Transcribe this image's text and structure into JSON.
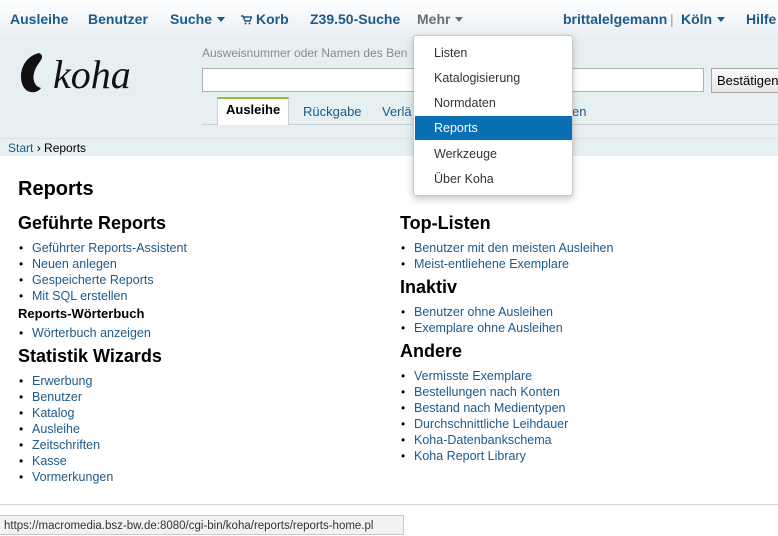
{
  "topnav": {
    "ausleihe": "Ausleihe",
    "benutzer": "Benutzer",
    "suche": "Suche",
    "korb": "Korb",
    "z3950": "Z39.50-Suche",
    "mehr": "Mehr",
    "user": "brittalelgemann",
    "separator": "|",
    "branch": "Köln",
    "hilfe": "Hilfe"
  },
  "search": {
    "hint": "Ausweisnummer oder Namen des Ben",
    "value": "",
    "submit": "Bestätigen"
  },
  "tabs": [
    "Ausleihe",
    "Rückgabe",
    "Verlä",
    "en"
  ],
  "breadcrumb": {
    "start": "Start",
    "separator": "›",
    "current": "Reports"
  },
  "dropdown": {
    "items": [
      "Listen",
      "Katalogisierung",
      "Normdaten",
      "Reports",
      "Werkzeuge",
      "Über Koha"
    ],
    "selected": "Reports"
  },
  "main": {
    "title": "Reports",
    "guided": {
      "heading": "Geführte Reports",
      "links": [
        "Geführter Reports-Assistent",
        "Neuen anlegen",
        "Gespeicherte Reports",
        "Mit SQL erstellen"
      ]
    },
    "dictionary": {
      "heading": "Reports-Wörterbuch",
      "links": [
        "Wörterbuch anzeigen"
      ]
    },
    "wizards": {
      "heading": "Statistik Wizards",
      "links": [
        "Erwerbung",
        "Benutzer",
        "Katalog",
        "Ausleihe",
        "Zeitschriften",
        "Kasse",
        "Vormerkungen"
      ]
    },
    "top": {
      "heading": "Top-Listen",
      "links": [
        "Benutzer mit den meisten Ausleihen",
        "Meist-entliehene Exemplare"
      ]
    },
    "inactive": {
      "heading": "Inaktiv",
      "links": [
        "Benutzer ohne Ausleihen",
        "Exemplare ohne Ausleihen"
      ]
    },
    "other": {
      "heading": "Andere",
      "links": [
        "Vermisste Exemplare",
        "Bestellungen nach Konten",
        "Bestand nach Medientypen",
        "Durchschnittliche Leihdauer",
        "Koha-Datenbankschema",
        "Koha Report Library"
      ]
    }
  },
  "statusbar": {
    "url": "https://macromedia.bsz-bw.de:8080/cgi-bin/koha/reports/reports-home.pl"
  },
  "colors": {
    "link": "#1c5a8c",
    "selected": "#0b6fb6",
    "header_bg": "#e6f0f2",
    "active_tab": "#8bbf3c"
  }
}
